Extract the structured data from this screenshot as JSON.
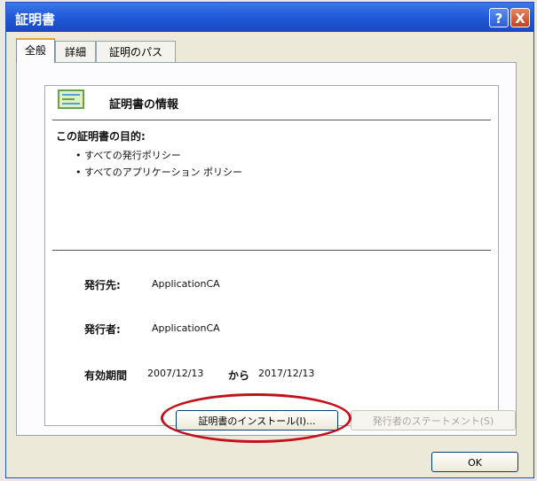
{
  "window": {
    "title": "証明書",
    "help_label": "?",
    "close_label": "X"
  },
  "tabs": [
    {
      "label": "全般",
      "active": true
    },
    {
      "label": "詳細",
      "active": false
    },
    {
      "label": "証明のパス",
      "active": false
    }
  ],
  "info": {
    "heading": "証明書の情報",
    "purpose_heading": "この証明書の目的:",
    "purposes": [
      "• すべての発行ポリシー",
      "• すべてのアプリケーション ポリシー"
    ],
    "issued_to_label": "発行先:",
    "issued_to_value": "ApplicationCA",
    "issued_by_label": "発行者:",
    "issued_by_value": "ApplicationCA",
    "validity_label": "有効期間",
    "valid_from": "2007/12/13",
    "validity_connector": "から",
    "valid_to": "2017/12/13"
  },
  "buttons": {
    "install": "証明書のインストール(I)...",
    "issuer_statement": "発行者のステートメント(S)",
    "ok": "OK"
  },
  "colors": {
    "titlebar": "#1f56d6",
    "highlight_ring": "#c1121c"
  }
}
